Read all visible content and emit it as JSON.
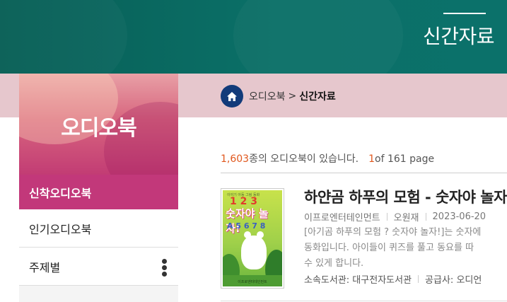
{
  "header": {
    "title": "신간자료"
  },
  "breadcrumb": {
    "home": "home-icon",
    "section": "오디오북",
    "separator": ">",
    "current": "신간자료"
  },
  "sidebar": {
    "title": "오디오북",
    "items": [
      {
        "label": "신착오디오북",
        "active": true
      },
      {
        "label": "인기오디오북",
        "active": false
      },
      {
        "label": "주제별",
        "active": false,
        "icon": "more-vertical-icon"
      }
    ]
  },
  "summary": {
    "count": "1,603",
    "count_text": " 종의 오디오북이 있습니다.",
    "page_current": "1",
    "page_text": " of 161 page"
  },
  "book": {
    "title": "하얀곰 하푸의 모험 - 숫자야 놀자!",
    "publisher": "이프로엔터테인먼트",
    "author": "오원재",
    "date": "2023-06-20",
    "description": [
      "[아기곰 하푸의 모험 ? 숫자야 놀자!]는 숫자에",
      "동화입니다. 아이들이 퀴즈를 풀고 동요를 따",
      "수 있게 합니다."
    ],
    "library": "소속도서관: 대구전자도서관",
    "supplier": "공급사: 오디언",
    "cover": {
      "small_text": "이야기 아동 그림 동화",
      "numbers": "1 2 3",
      "title": "숫자야 놀자!",
      "row2": "A 5 6 7 8",
      "publisher": "이프로엔터테인먼트"
    }
  },
  "colors": {
    "header": "#0b6e66",
    "accent": "#c2387a",
    "count": "#e0571d",
    "home": "#123b7a"
  }
}
